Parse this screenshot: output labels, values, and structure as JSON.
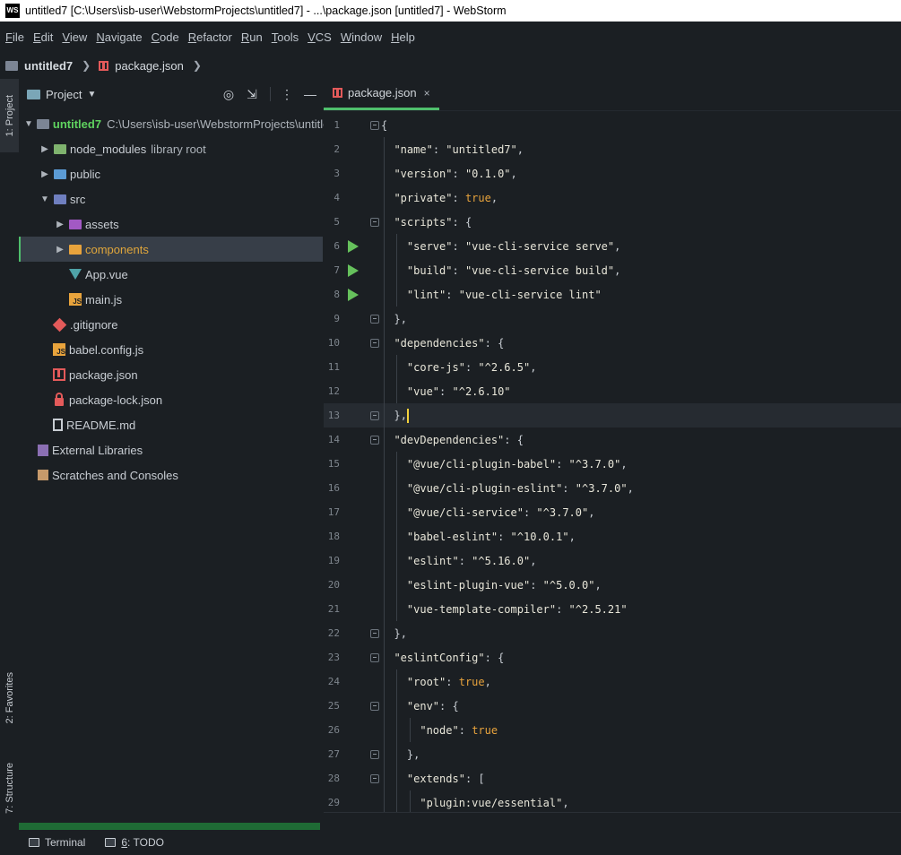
{
  "window": {
    "title": "untitled7 [C:\\Users\\isb-user\\WebstormProjects\\untitled7] - ...\\package.json [untitled7] - WebStorm",
    "logo_text": "WS"
  },
  "menu": [
    {
      "mnemonic": "F",
      "rest": "ile"
    },
    {
      "mnemonic": "E",
      "rest": "dit"
    },
    {
      "mnemonic": "V",
      "rest": "iew"
    },
    {
      "mnemonic": "N",
      "rest": "avigate"
    },
    {
      "mnemonic": "C",
      "rest": "ode"
    },
    {
      "mnemonic": "R",
      "rest": "efactor"
    },
    {
      "mnemonic": "R",
      "rest": "un"
    },
    {
      "mnemonic": "T",
      "rest": "ools"
    },
    {
      "mnemonic": "V",
      "rest": "CS"
    },
    {
      "mnemonic": "W",
      "rest": "indow"
    },
    {
      "mnemonic": "H",
      "rest": "elp"
    }
  ],
  "breadcrumb": {
    "project": "untitled7",
    "file": "package.json"
  },
  "side_tabs": {
    "project": "1: Project",
    "favorites": "2: Favorites",
    "structure": "7: Structure"
  },
  "project_panel": {
    "title": "Project",
    "tree": {
      "root_name": "untitled7",
      "root_path": "C:\\Users\\isb-user\\WebstormProjects\\untitled7",
      "node_modules": "node_modules",
      "node_modules_hint": "library root",
      "public": "public",
      "src": "src",
      "assets": "assets",
      "components": "components",
      "app_vue": "App.vue",
      "main_js": "main.js",
      "gitignore": ".gitignore",
      "babel_config": "babel.config.js",
      "package_json": "package.json",
      "package_lock": "package-lock.json",
      "readme": "README.md",
      "external_libraries": "External Libraries",
      "scratches": "Scratches and Consoles"
    }
  },
  "editor": {
    "tab_label": "package.json",
    "tab_close": "×",
    "current_line": 13,
    "lines": [
      {
        "n": "1",
        "text": "{"
      },
      {
        "n": "2",
        "text": "  \"name\": \"untitled7\","
      },
      {
        "n": "3",
        "text": "  \"version\": \"0.1.0\","
      },
      {
        "n": "4",
        "text": "  \"private\": true,"
      },
      {
        "n": "5",
        "text": "  \"scripts\": {"
      },
      {
        "n": "6",
        "text": "    \"serve\": \"vue-cli-service serve\","
      },
      {
        "n": "7",
        "text": "    \"build\": \"vue-cli-service build\","
      },
      {
        "n": "8",
        "text": "    \"lint\": \"vue-cli-service lint\""
      },
      {
        "n": "9",
        "text": "  },"
      },
      {
        "n": "10",
        "text": "  \"dependencies\": {"
      },
      {
        "n": "11",
        "text": "    \"core-js\": \"^2.6.5\","
      },
      {
        "n": "12",
        "text": "    \"vue\": \"^2.6.10\""
      },
      {
        "n": "13",
        "text": "  },"
      },
      {
        "n": "14",
        "text": "  \"devDependencies\": {"
      },
      {
        "n": "15",
        "text": "    \"@vue/cli-plugin-babel\": \"^3.7.0\","
      },
      {
        "n": "16",
        "text": "    \"@vue/cli-plugin-eslint\": \"^3.7.0\","
      },
      {
        "n": "17",
        "text": "    \"@vue/cli-service\": \"^3.7.0\","
      },
      {
        "n": "18",
        "text": "    \"babel-eslint\": \"^10.0.1\","
      },
      {
        "n": "19",
        "text": "    \"eslint\": \"^5.16.0\","
      },
      {
        "n": "20",
        "text": "    \"eslint-plugin-vue\": \"^5.0.0\","
      },
      {
        "n": "21",
        "text": "    \"vue-template-compiler\": \"^2.5.21\""
      },
      {
        "n": "22",
        "text": "  },"
      },
      {
        "n": "23",
        "text": "  \"eslintConfig\": {"
      },
      {
        "n": "24",
        "text": "    \"root\": true,"
      },
      {
        "n": "25",
        "text": "    \"env\": {"
      },
      {
        "n": "26",
        "text": "      \"node\": true"
      },
      {
        "n": "27",
        "text": "    },"
      },
      {
        "n": "28",
        "text": "    \"extends\": ["
      },
      {
        "n": "29",
        "text": "      \"plugin:vue/essential\","
      }
    ]
  },
  "bottom_bar": {
    "terminal": "Terminal",
    "todo_num": "6",
    "todo_rest": ": TODO"
  },
  "colors": {
    "accent_green": "#4fbf6c",
    "run_gutter": "#66c15c",
    "boolean": "#e8a33c",
    "caret": "#f2d13c"
  }
}
